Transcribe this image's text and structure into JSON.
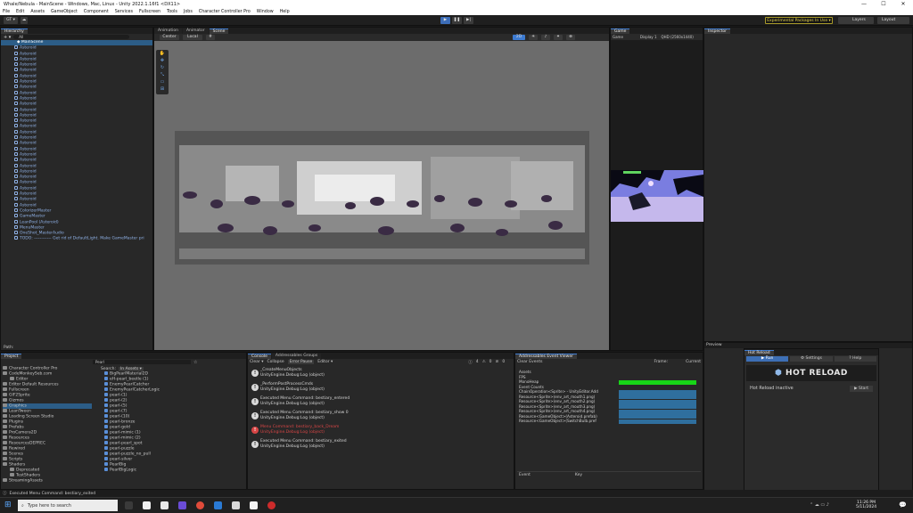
{
  "titlebar": {
    "title": "Whale/Nebula - MainScene - Windows, Mac, Linux - Unity 2022.1.16f1 <DX11>",
    "controls": [
      "—",
      "☐",
      "✕"
    ]
  },
  "menu": [
    "File",
    "Edit",
    "Assets",
    "GameObject",
    "Component",
    "Services",
    "Fullscreen",
    "Tools",
    "Jobs",
    "Character Controller Pro",
    "Window",
    "Help"
  ],
  "toolbar": {
    "experimental": "Experimental Packages In Use ▾",
    "layers": "Layers",
    "layout": "Layout",
    "account": "GT ▾"
  },
  "hierarchy": {
    "tab": "Hierarchy",
    "search_placeholder": "All",
    "scene": "MainScene",
    "items": [
      "Asteroid",
      "Asteroid",
      "Asteroid",
      "Asteroid",
      "Asteroid",
      "Asteroid",
      "Asteroid",
      "Asteroid",
      "Asteroid",
      "Asteroid",
      "Asteroid",
      "Asteroid",
      "Asteroid",
      "Asteroid",
      "Asteroid",
      "Asteroid",
      "Asteroid",
      "Asteroid",
      "Asteroid",
      "Asteroid",
      "Asteroid",
      "Asteroid",
      "Asteroid",
      "Asteroid",
      "Asteroid",
      "Asteroid",
      "Asteroid",
      "Asteroid",
      "Asteroid",
      "ColorizerMaster",
      "GameMaster",
      "LeanPool (Asteroid)",
      "MenuMaster",
      "OneShot_MasterAudio",
      "TODO: ------------ Get rid of DefaultLight. Make GameMaster pri"
    ],
    "path": "Path:"
  },
  "scene_tabs": [
    "Animation",
    "Animator",
    "Scene"
  ],
  "scene_toolbar": {
    "pivot": "Center",
    "space": "Local",
    "mode": "2D"
  },
  "game": {
    "tab": "Game",
    "mode": "Game",
    "display": "Display 1",
    "resolution": "QHD (2560x1440)"
  },
  "inspector": {
    "tab": "Inspector"
  },
  "preview": {
    "label": "Preview"
  },
  "hot_reload": {
    "tab": "Hot Reload",
    "run": "▶ Run",
    "settings": "⚙ Settings",
    "help": "? Help",
    "logo": "HOT RELOAD",
    "status": "Hot Reload inactive",
    "start": "▶ Start"
  },
  "project": {
    "tab": "Project",
    "folders": [
      "Character Controller Pro",
      "CodeMonkeySeb.com",
      "Editor",
      "Editor Default Resources",
      "Fullscreen",
      "GIF2Sprite",
      "Gizmos",
      "Graphics",
      "LeanTween",
      "Loading Screen Studio",
      "Plugins",
      "Prefabs",
      "ProCamera2D",
      "Resources",
      "ResourcesDEPREC",
      "Rewired",
      "Scenes",
      "Scripts",
      "Shaders",
      "Deprecated",
      "TestShaders",
      "StreamingAssets"
    ],
    "search_value": "Pearl",
    "search_scope": "In Assets ▾",
    "search_label": "Search:",
    "results": [
      "BigPearlMaterial2D",
      "eH-pearl_beetle (1)",
      "EnemyPearlCatcher",
      "EnemyPearlCatcherLogic",
      "pearl-(1)",
      "pearl-(2)",
      "pearl-(5)",
      "pearl-(7)",
      "pearl-(10)",
      "pearl-bronze",
      "pearl-gold",
      "pearl-mimic (1)",
      "pearl-mimic (2)",
      "pearl-pearl_spot",
      "pearl-puzzle",
      "pearl-puzzle_no_pull",
      "pearl-silver",
      "PearlBig",
      "PearlBigLogic"
    ]
  },
  "console": {
    "tabs": [
      "Console",
      "Addressables Groups"
    ],
    "toolbar": [
      "Clear ▾",
      "Collapse",
      "Error Pause",
      "Editor ▾"
    ],
    "counts": [
      "4",
      "0",
      "0"
    ],
    "logs": [
      {
        "line1": "_CreateMenuObjects",
        "line2": "UnityEngine.Debug:Log (object)",
        "err": false
      },
      {
        "line1": "_PerformPostProcessCmds",
        "line2": "UnityEngine.Debug:Log (object)",
        "err": false
      },
      {
        "line1": "Executed Menu Command: bestiary_entered",
        "line2": "UnityEngine.Debug:Log (object)",
        "err": false
      },
      {
        "line1": "Executed Menu Command: bestiary_show 0",
        "line2": "UnityEngine.Debug:Log (object)",
        "err": false
      },
      {
        "line1": "Menu Command: bestiary_back_Dream",
        "line2": "UnityEngine.Debug:Log (object)",
        "err": true
      },
      {
        "line1": "Executed Menu Command: bestiary_exited",
        "line2": "UnityEngine.Debug:Log (object)",
        "err": false
      }
    ]
  },
  "events": {
    "tab": "Addressables Event Viewer",
    "clear": "Clear Events",
    "frame": "Frame:",
    "current": "Current",
    "rows": [
      "Assets",
      "FPS",
      "MonoHeap",
      "Event Counts",
      "ChainOperation<Sprite> - UnityEditor.Add",
      "Resource<Sprite>(env_art_mouth1.png)",
      "Resource<Sprite>(env_art_mouth2.png)",
      "Resource<Sprite>(env_art_mouth3.png)",
      "Resource<Sprite>(env_art_mouth4.png)",
      "Resource<GameObject>(Asteroid.prefab)",
      "Resource<GameObject>(SwitchBulb.pref"
    ],
    "col_event": "Event",
    "col_key": "Key"
  },
  "status_message": "Executed Menu Command: bestiary_exited",
  "taskbar": {
    "search_placeholder": "Type here to search",
    "time": "11:26 PM",
    "date": "5/11/2024"
  },
  "colors": {
    "accent": "#3d7bd1",
    "play": "#3c6db8",
    "meter_green": "#17d617",
    "event_blue": "#2f6f9e",
    "error": "#d74545"
  }
}
